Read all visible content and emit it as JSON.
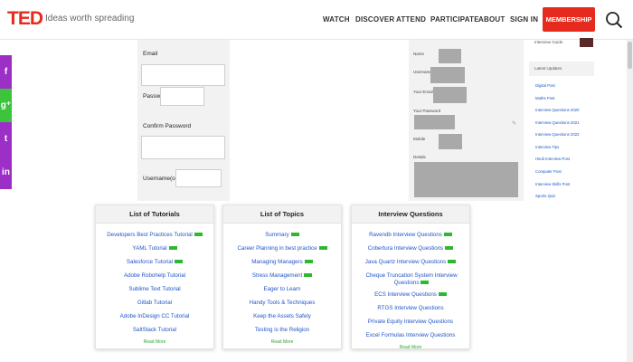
{
  "header": {
    "logo": "TED",
    "tagline": "Ideas worth spreading",
    "nav": [
      "WATCH",
      "DISCOVER",
      "ATTEND",
      "PARTICIPATE",
      "ABOUT",
      "SIGN IN"
    ],
    "membership": "MEMBERSHIP"
  },
  "social": [
    {
      "icon": "facebook-icon",
      "glyph": "f",
      "color": "#9b2fc6"
    },
    {
      "icon": "google-plus-icon",
      "glyph": "g⁺",
      "color": "#3cc43c"
    },
    {
      "icon": "twitter-icon",
      "glyph": "t",
      "color": "#9b2fc6"
    },
    {
      "icon": "linkedin-icon",
      "glyph": "in",
      "color": "#9b2fc6"
    }
  ],
  "form": {
    "email_label": "Email",
    "password_label": "Password",
    "confirm_label": "Confirm Password",
    "username_label": "Username(optional)"
  },
  "right_form": {
    "labels": [
      "Name",
      "Username",
      "Your Email",
      "Your Password",
      "Mobile",
      "Details"
    ]
  },
  "sidebar": {
    "top_text": "Interview Guide",
    "heading": "Latest Updates",
    "links": [
      "Digital Post",
      "Maths Post",
      "Interview Questions 2020",
      "Interview Questions 2021",
      "Interview Questions 2022",
      "Interview Tips",
      "Hindi Interview Post",
      "Computer Post",
      "Interview Skills Post",
      "Sports Quiz"
    ]
  },
  "cards": [
    {
      "title": "List of Tutorials",
      "links": [
        {
          "text": "Developers Best Practices Tutorial",
          "new": true
        },
        {
          "text": "YAML Tutorial",
          "new": true
        },
        {
          "text": "Salesforce Tutorial",
          "new": true
        },
        {
          "text": "Adobe Robohelp Tutorial",
          "new": false
        },
        {
          "text": "Sublime Text Tutorial",
          "new": false
        },
        {
          "text": "Gitlab Tutorial",
          "new": false
        },
        {
          "text": "Adobe InDesign CC Tutorial",
          "new": false
        },
        {
          "text": "SaltStack Tutorial",
          "new": false
        }
      ],
      "read_more": "Read More"
    },
    {
      "title": "List of Topics",
      "links": [
        {
          "text": "Summary",
          "new": true
        },
        {
          "text": "Career Planning in best practice",
          "new": true
        },
        {
          "text": "Managing Managers",
          "new": true
        },
        {
          "text": "Stress Management",
          "new": true
        },
        {
          "text": "Eager to Learn",
          "new": false
        },
        {
          "text": "Handy Tools & Techniques",
          "new": false
        },
        {
          "text": "Keep the Assets Safely",
          "new": false
        },
        {
          "text": "Testing is the Religion",
          "new": false
        }
      ],
      "read_more": "Read More"
    },
    {
      "title": "Interview Questions",
      "links": [
        {
          "text": "Ravendb Interview Questions",
          "new": true
        },
        {
          "text": "Cobertura Interview Questions",
          "new": true
        },
        {
          "text": "Java Quartz Interview Questions",
          "new": true
        },
        {
          "text": "Cheque Truncation System Interview Questions",
          "new": true
        },
        {
          "text": "ECS Interview Questions",
          "new": true
        },
        {
          "text": "RTGS Interview Questions",
          "new": false
        },
        {
          "text": "Private Equity Interview Questions",
          "new": false
        },
        {
          "text": "Excel Formulas Interview Questions",
          "new": false
        }
      ],
      "read_more": "Read More"
    }
  ]
}
